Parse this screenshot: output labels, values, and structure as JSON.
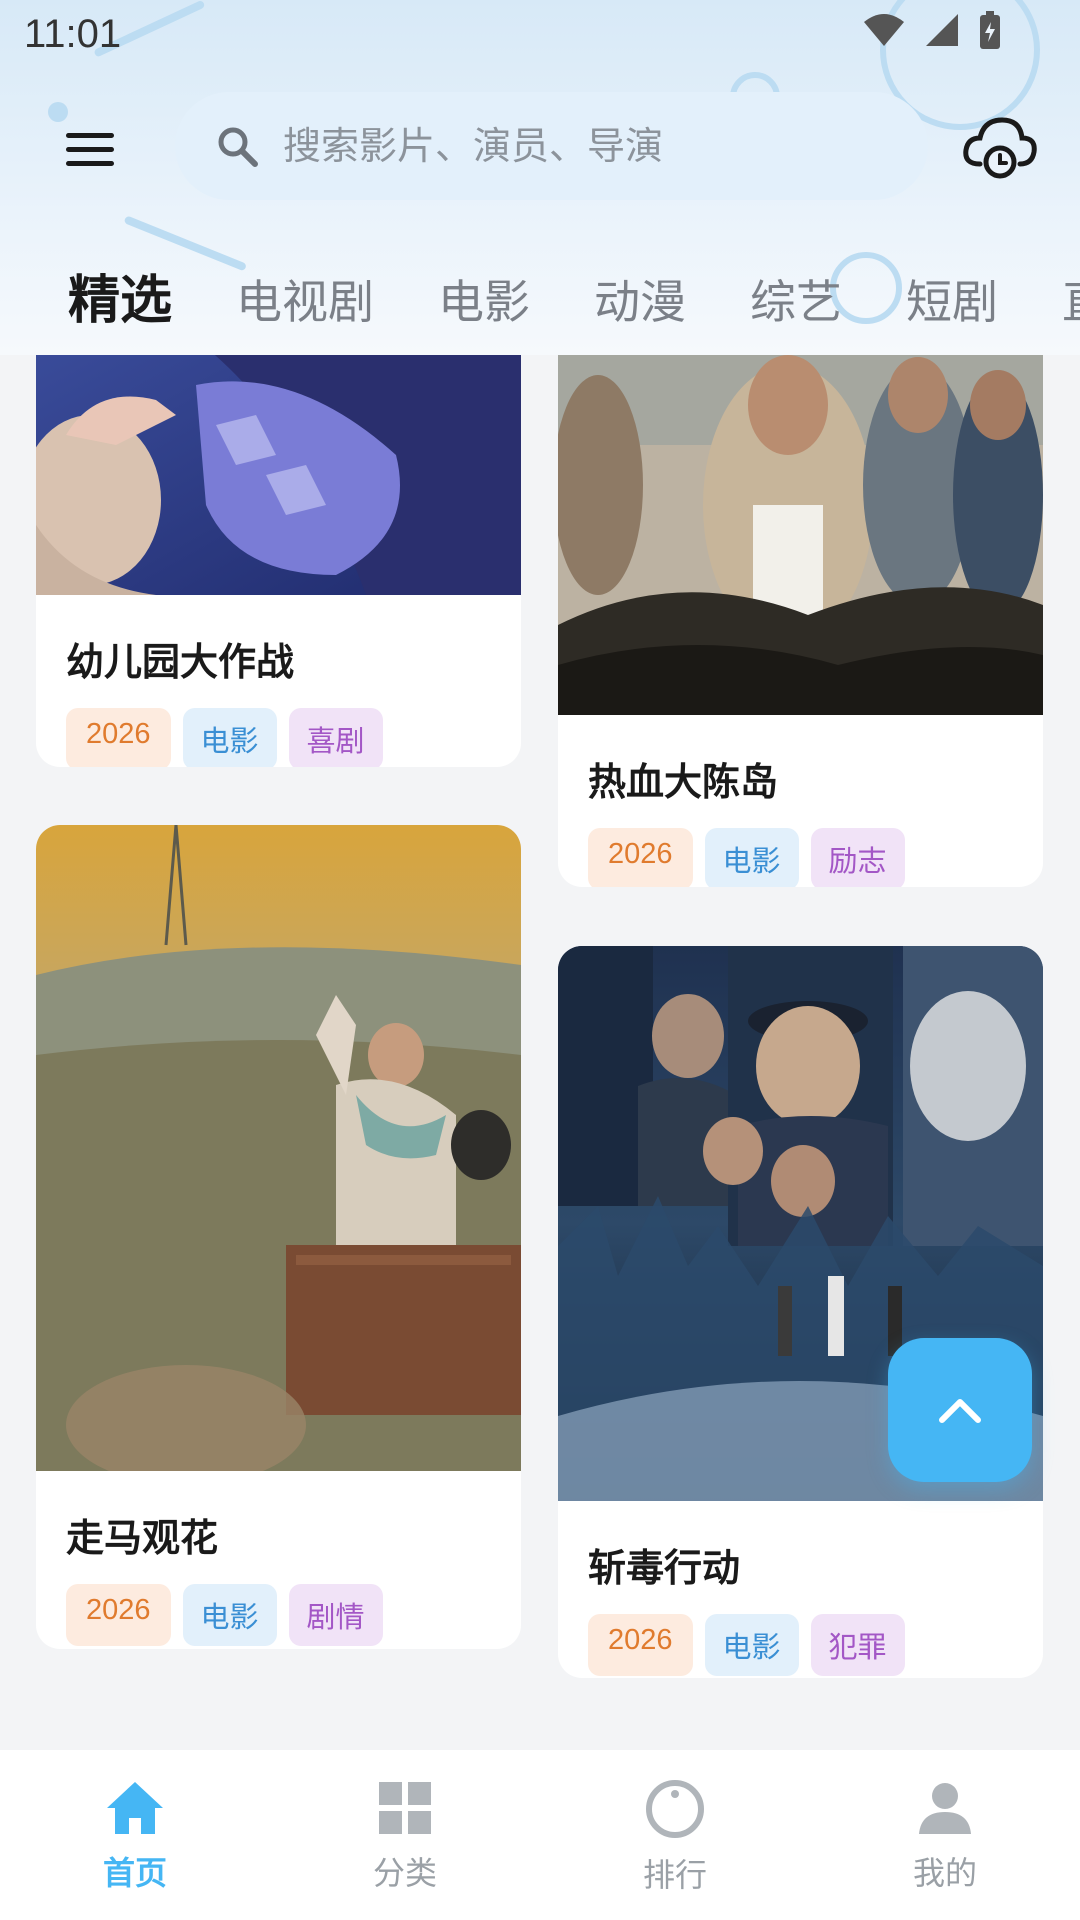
{
  "status_bar": {
    "time": "11:01"
  },
  "search": {
    "placeholder": "搜索影片、演员、导演"
  },
  "tabs": [
    "精选",
    "电视剧",
    "电影",
    "动漫",
    "综艺",
    "短剧",
    "直播"
  ],
  "cards": [
    {
      "title": "幼儿园大作战",
      "year": "2026",
      "type": "电影",
      "genre": "喜剧"
    },
    {
      "title": "热血大陈岛",
      "year": "2026",
      "type": "电影",
      "genre": "励志"
    },
    {
      "title": "走马观花",
      "year": "2026",
      "type": "电影",
      "genre": "剧情"
    },
    {
      "title": "斩毒行动",
      "year": "2026",
      "type": "电影",
      "genre": "犯罪"
    }
  ],
  "bottom_nav": [
    {
      "label": "首页",
      "icon": "home-icon",
      "active": true
    },
    {
      "label": "分类",
      "icon": "grid-icon",
      "active": false
    },
    {
      "label": "排行",
      "icon": "ranking-icon",
      "active": false
    },
    {
      "label": "我的",
      "icon": "profile-icon",
      "active": false
    }
  ],
  "colors": {
    "accent": "#45b6f4",
    "tag_year": "#e07b2e",
    "tag_type": "#3a8fd4",
    "tag_genre": "#a357c6"
  }
}
